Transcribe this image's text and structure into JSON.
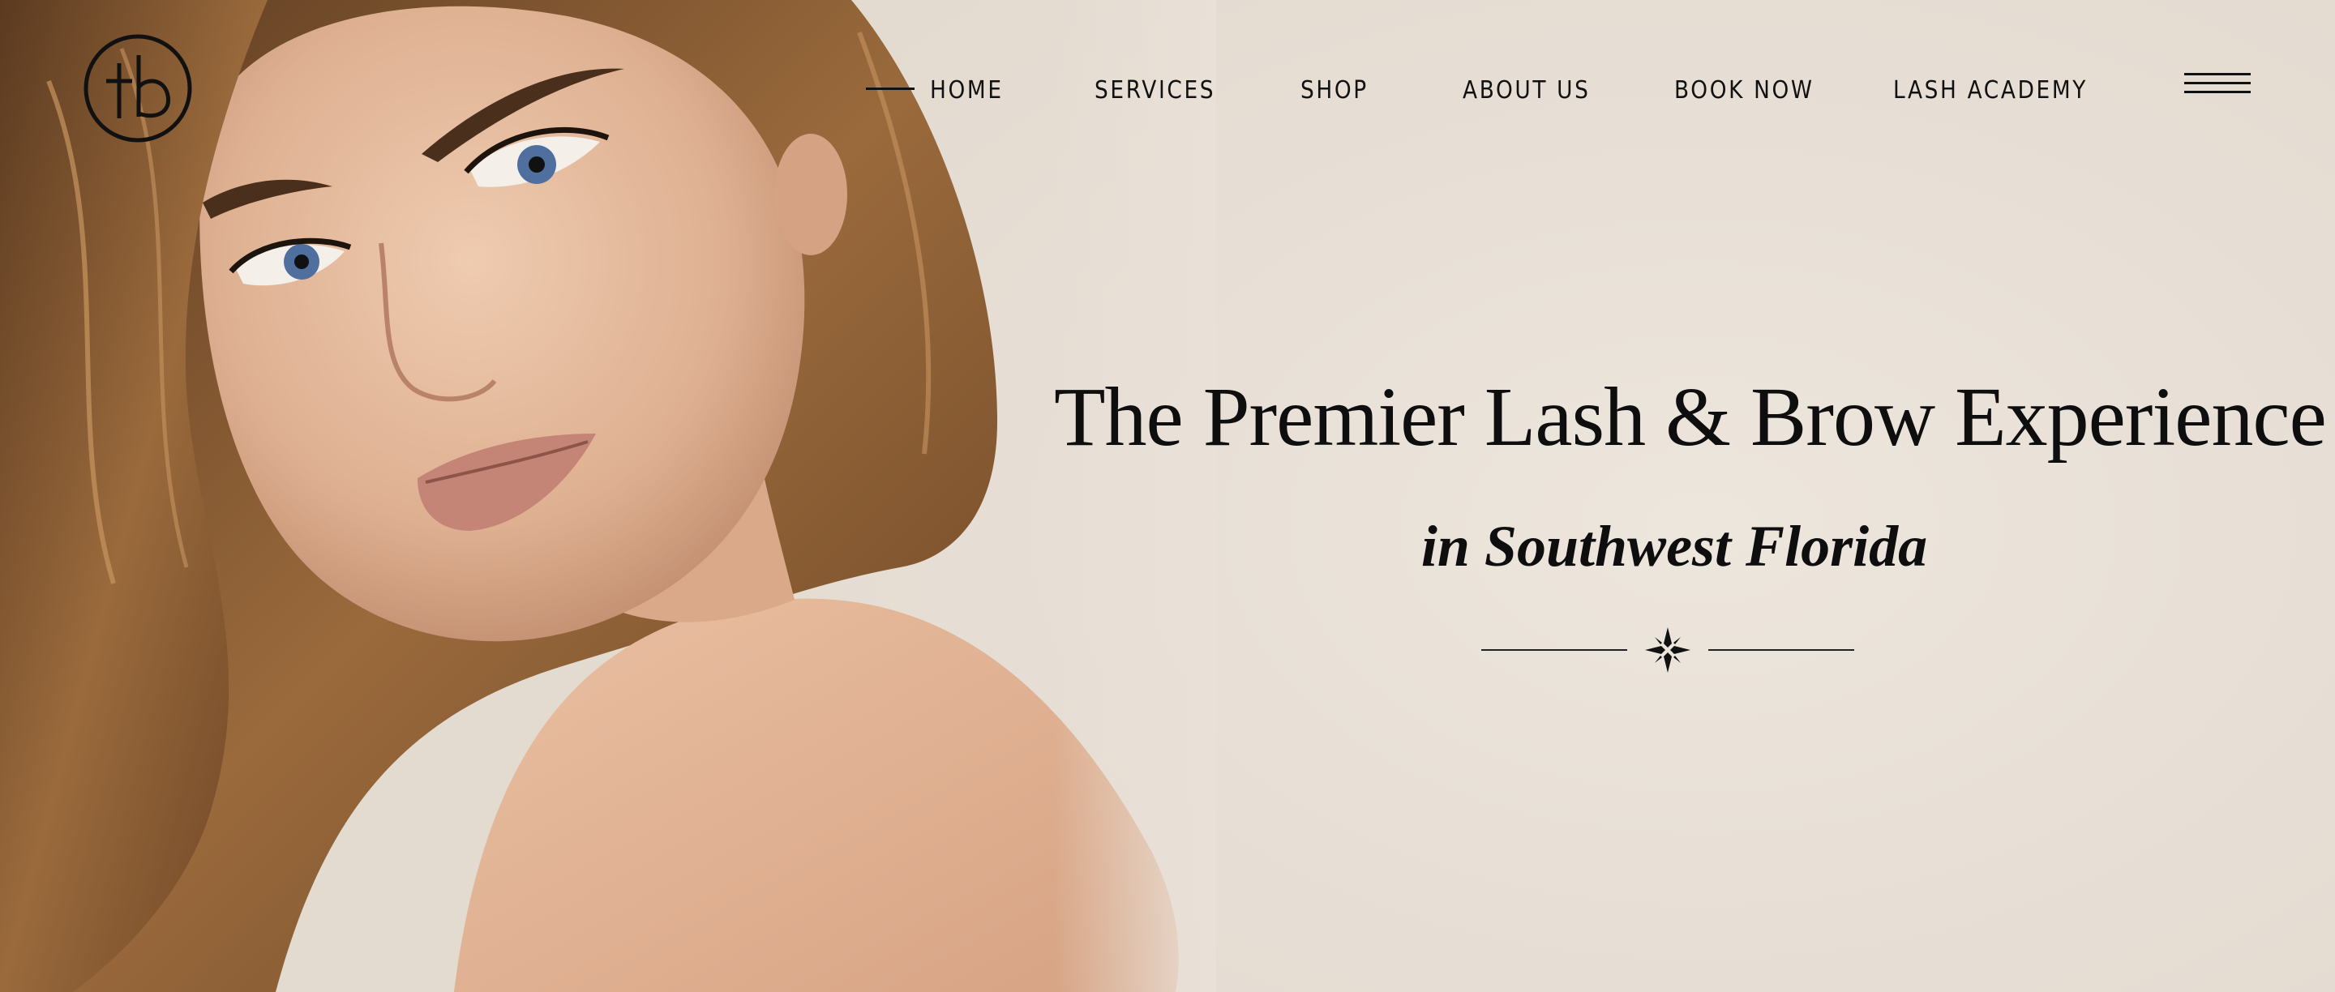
{
  "brand": {
    "logo_name": "tb-monogram-logo"
  },
  "nav": {
    "items": [
      {
        "label": "HOME"
      },
      {
        "label": "SERVICES"
      },
      {
        "label": "SHOP"
      },
      {
        "label": "ABOUT US"
      },
      {
        "label": "BOOK NOW"
      },
      {
        "label": "LASH ACADEMY"
      }
    ],
    "active_index": 0,
    "menu_icon": "hamburger-menu-icon"
  },
  "hero": {
    "headline": "The Premier Lash & Brow Experience",
    "subheadline": "in Southwest Florida",
    "ornament_icon": "diamond-sparkle-icon",
    "image_subject": "woman-portrait-photo"
  },
  "colors": {
    "background": "#e9e1d7",
    "text": "#0e0e0e",
    "hair": "#8a5a32",
    "skin": "#e2b596"
  }
}
